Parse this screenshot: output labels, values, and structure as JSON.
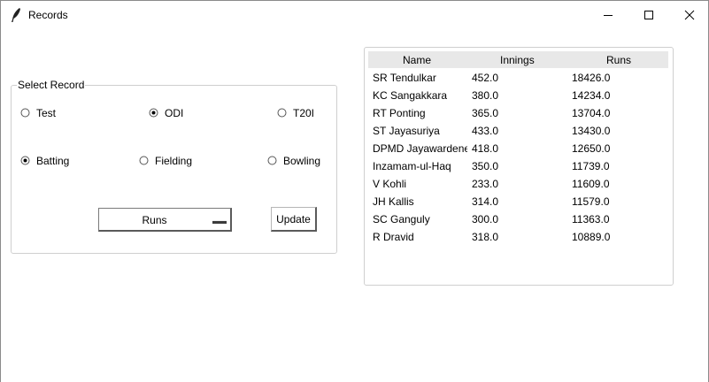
{
  "window": {
    "title": "Records",
    "controls": [
      "minimize-icon",
      "maximize-icon",
      "close-icon"
    ]
  },
  "record_frame": {
    "legend": "Select Record",
    "format_options": [
      {
        "label": "Test",
        "selected": false
      },
      {
        "label": "ODI",
        "selected": true
      },
      {
        "label": "T20I",
        "selected": false
      }
    ],
    "category_options": [
      {
        "label": "Batting",
        "selected": true
      },
      {
        "label": "Fielding",
        "selected": false
      },
      {
        "label": "Bowling",
        "selected": false
      }
    ],
    "stat_dropdown": {
      "selected": "Runs"
    },
    "update_label": "Update"
  },
  "table": {
    "columns": [
      "Name",
      "Innings",
      "Runs"
    ],
    "rows": [
      [
        "SR Tendulkar",
        "452.0",
        "18426.0"
      ],
      [
        "KC Sangakkara",
        "380.0",
        "14234.0"
      ],
      [
        "RT Ponting",
        "365.0",
        "13704.0"
      ],
      [
        "ST Jayasuriya",
        "433.0",
        "13430.0"
      ],
      [
        "DPMD Jayawardene",
        "418.0",
        "12650.0"
      ],
      [
        "Inzamam-ul-Haq",
        "350.0",
        "11739.0"
      ],
      [
        "V Kohli",
        "233.0",
        "11609.0"
      ],
      [
        "JH Kallis",
        "314.0",
        "11579.0"
      ],
      [
        "SC Ganguly",
        "300.0",
        "11363.0"
      ],
      [
        "R Dravid",
        "318.0",
        "10889.0"
      ]
    ]
  },
  "colors": {
    "header_bg": "#e8e8e8",
    "frame_border": "#cfcfcf"
  }
}
